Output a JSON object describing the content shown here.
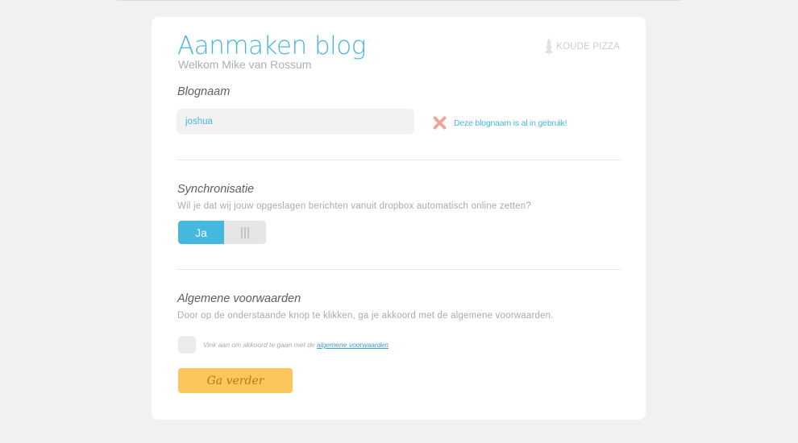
{
  "header": {
    "title": "Aanmaken blog",
    "subtitle": "Welkom Mike van Rossum",
    "brand": "KOUDE PIZZA",
    "brand_icon": "pine-tree-icon"
  },
  "blogname": {
    "heading": "Blognaam",
    "value": "joshua",
    "error_icon": "close-x-icon",
    "error_text": "Deze blognaam is al in gebruik!"
  },
  "sync": {
    "heading": "Synchronisatie",
    "description": "Wil je dat wij jouw opgeslagen berichten vanuit dropbox automatisch online zetten?",
    "toggle_label": "Ja",
    "toggle_on": true
  },
  "terms": {
    "heading": "Algemene voorwaarden",
    "description": "Door op de onderstaande knop te klikken, ga je akkoord met de algemene voorwaarden.",
    "checkbox_text": "Vink aan om akkoord te gaan met de ",
    "checkbox_link": "algemene voorwaarden",
    "checked": false
  },
  "submit_label": "Ga verder",
  "colors": {
    "accent": "#45b8de",
    "button": "#fcc65c",
    "error_icon": "#f0a59c"
  }
}
